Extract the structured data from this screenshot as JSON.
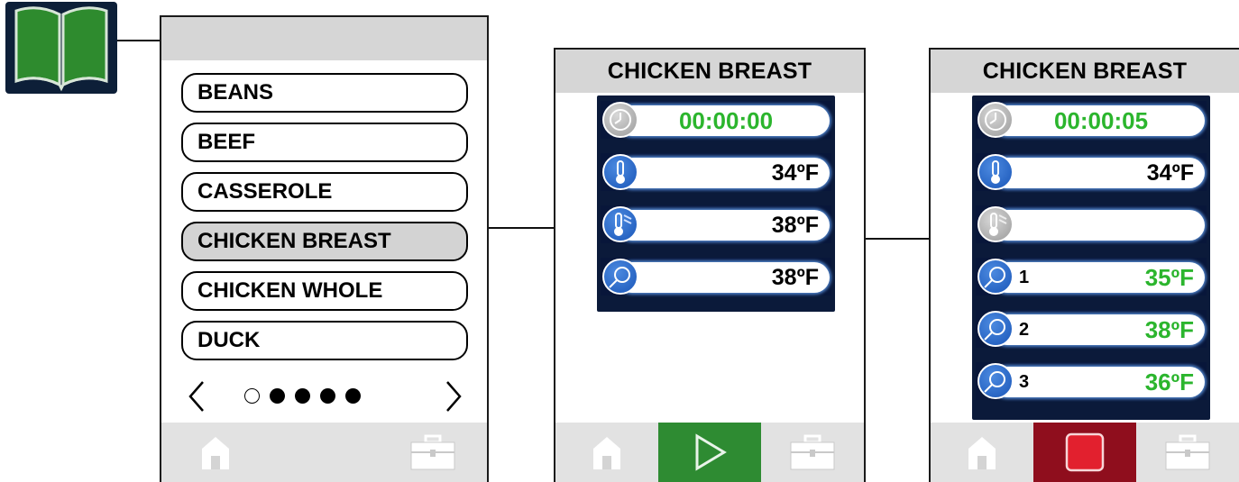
{
  "recipe_book_icon": "open-book-icon",
  "screen1": {
    "header": "",
    "items": [
      "BEANS",
      "BEEF",
      "CASSEROLE",
      "CHICKEN BREAST",
      "CHICKEN WHOLE",
      "DUCK"
    ],
    "selected": "CHICKEN BREAST",
    "pager": {
      "current": 1,
      "total": 5
    },
    "nav": {
      "prev": "<",
      "next": ">"
    }
  },
  "screen2": {
    "header": "CHICKEN BREAST",
    "timer": "00:00:00",
    "cabinet_temp": "34ºF",
    "setpoint_temp": "38ºF",
    "probe_temp": "38ºF",
    "action": "start"
  },
  "screen3": {
    "header": "CHICKEN BREAST",
    "timer": "00:00:05",
    "cabinet_temp": "34ºF",
    "setpoint_temp": "",
    "probes": [
      {
        "number": "1",
        "value": "35ºF"
      },
      {
        "number": "2",
        "value": "38ºF"
      },
      {
        "number": "3",
        "value": "36ºF"
      }
    ],
    "action": "stop"
  },
  "colors": {
    "header_bg": "#d6d6d6",
    "panel_bg": "#0b1a3a",
    "reading_green": "#2bb52d",
    "start_green": "#2e8b32",
    "stop_red": "#8f0e1d",
    "book_green": "#2e8b2e"
  }
}
